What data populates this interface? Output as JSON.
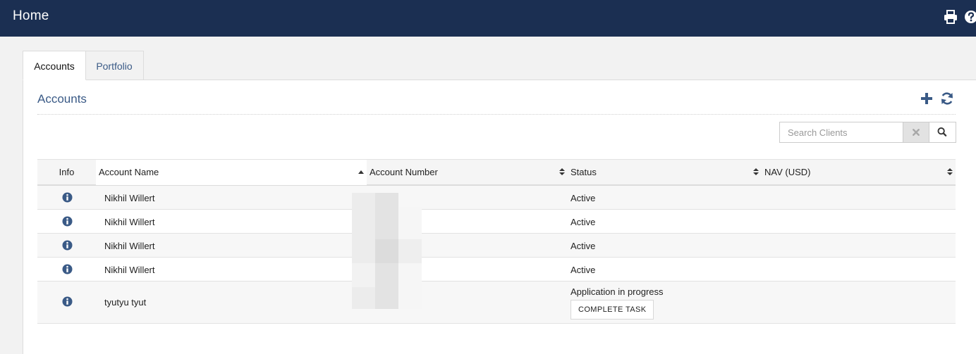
{
  "header": {
    "title": "Home",
    "icons": [
      "print-icon",
      "help-icon"
    ],
    "background": "#1b2f52"
  },
  "tabs": [
    {
      "label": "Accounts",
      "active": true
    },
    {
      "label": "Portfolio",
      "active": false
    }
  ],
  "section": {
    "title": "Accounts",
    "tools": [
      "plus-icon",
      "refresh-icon"
    ],
    "accent": "#3a5a86"
  },
  "search": {
    "placeholder": "Search Clients",
    "value": ""
  },
  "table": {
    "columns": [
      {
        "label": "Info"
      },
      {
        "label": "Account Name",
        "sort": "ascending"
      },
      {
        "label": "Account Number",
        "sort": "none"
      },
      {
        "label": "Status",
        "sort": "none"
      },
      {
        "label": "NAV (USD)",
        "sort": "none"
      }
    ],
    "rows": [
      {
        "name": "Nikhil Willert",
        "account_number": "",
        "status": "Active",
        "nav": ""
      },
      {
        "name": "Nikhil Willert",
        "account_number": "",
        "status": "Active",
        "nav": ""
      },
      {
        "name": "Nikhil Willert",
        "account_number": "",
        "status": "Active",
        "nav": ""
      },
      {
        "name": "Nikhil Willert",
        "account_number": "",
        "status": "Active",
        "nav": ""
      },
      {
        "name": "tyutyu tyut",
        "account_number": "",
        "status": "Application in progress",
        "nav": "",
        "action": "COMPLETE TASK"
      }
    ]
  }
}
